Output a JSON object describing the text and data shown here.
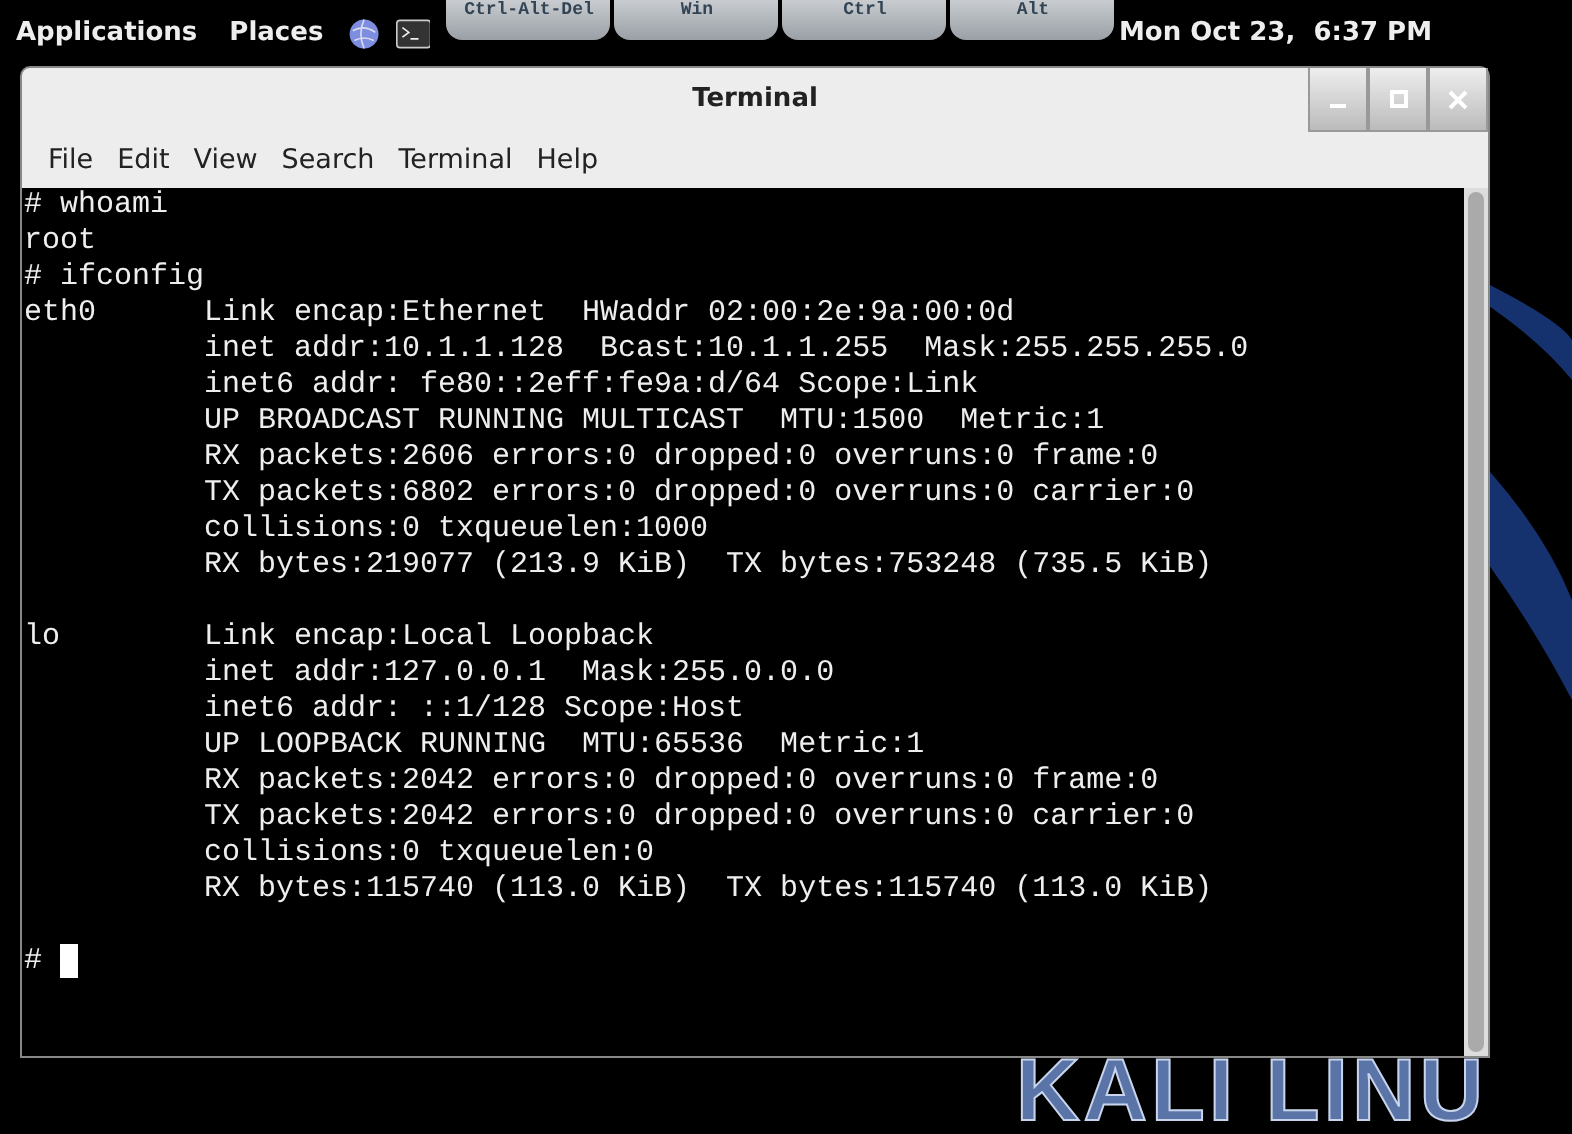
{
  "top_panel": {
    "menus": [
      "Applications",
      "Places"
    ],
    "keys": [
      "Ctrl-Alt-Del",
      "Win",
      "Ctrl",
      "Alt"
    ],
    "clock": "Mon Oct 23,  6:37 PM"
  },
  "window": {
    "title": "Terminal",
    "menu": [
      "File",
      "Edit",
      "View",
      "Search",
      "Terminal",
      "Help"
    ],
    "blocks": [
      [
        "# whoami",
        "root",
        "# ifconfig",
        "eth0      Link encap:Ethernet  HWaddr 02:00:2e:9a:00:0d  ",
        "          inet addr:10.1.1.128  Bcast:10.1.1.255  Mask:255.255.255.0",
        "          inet6 addr: fe80::2eff:fe9a:d/64 Scope:Link",
        "          UP BROADCAST RUNNING MULTICAST  MTU:1500  Metric:1",
        "          RX packets:2606 errors:0 dropped:0 overruns:0 frame:0",
        "          TX packets:6802 errors:0 dropped:0 overruns:0 carrier:0",
        "          collisions:0 txqueuelen:1000 ",
        "          RX bytes:219077 (213.9 KiB)  TX bytes:753248 (735.5 KiB)"
      ],
      [
        "lo        Link encap:Local Loopback  ",
        "          inet addr:127.0.0.1  Mask:255.0.0.0",
        "          inet6 addr: ::1/128 Scope:Host",
        "          UP LOOPBACK RUNNING  MTU:65536  Metric:1",
        "          RX packets:2042 errors:0 dropped:0 overruns:0 frame:0",
        "          TX packets:2042 errors:0 dropped:0 overruns:0 carrier:0",
        "          collisions:0 txqueuelen:0 ",
        "          RX bytes:115740 (113.0 KiB)  TX bytes:115740 (113.0 KiB)"
      ],
      [
        "#"
      ]
    ]
  },
  "wallpaper": {
    "text": "KALI LINU"
  }
}
